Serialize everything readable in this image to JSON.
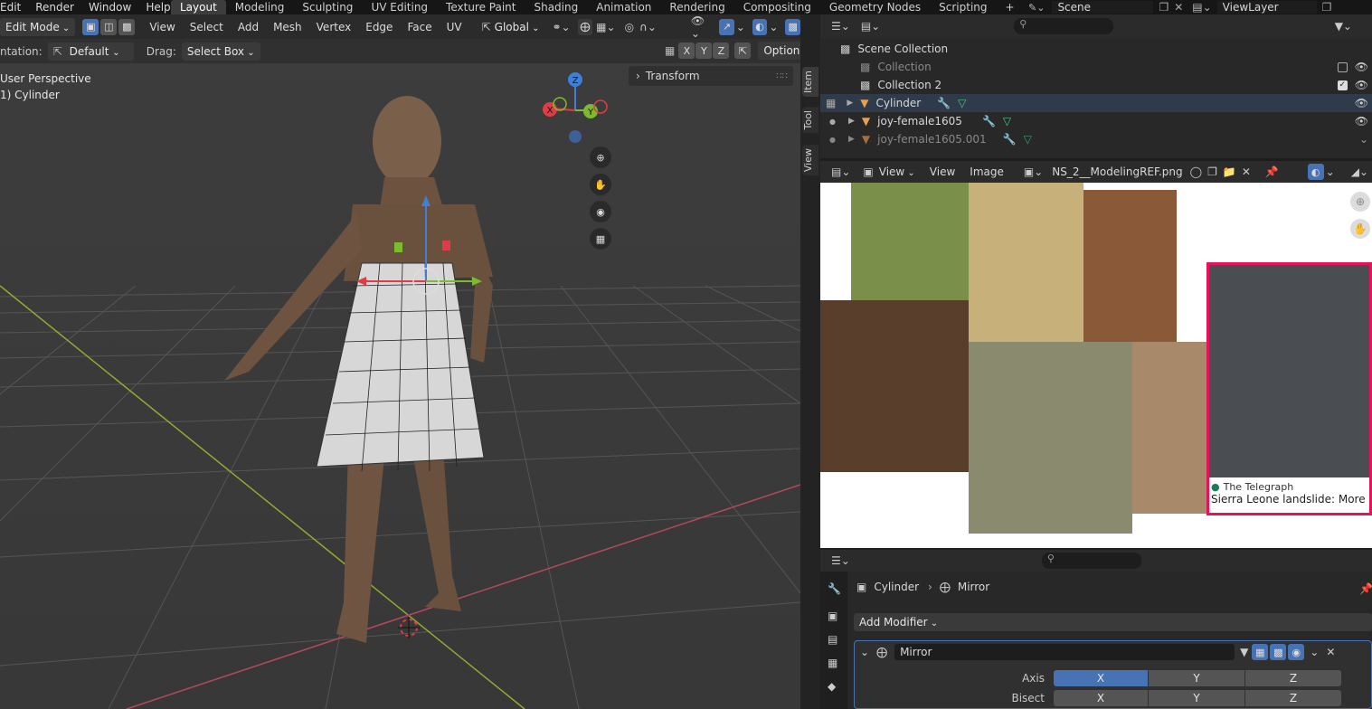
{
  "menu": [
    "Edit",
    "Render",
    "Window",
    "Help"
  ],
  "workspaces": [
    "Layout",
    "Modeling",
    "Sculpting",
    "UV Editing",
    "Texture Paint",
    "Shading",
    "Animation",
    "Rendering",
    "Compositing",
    "Geometry Nodes",
    "Scripting"
  ],
  "active_workspace": "Layout",
  "add_workspace": "+",
  "scene": "Scene",
  "view_layer": "ViewLayer",
  "viewport": {
    "mode": "Edit Mode",
    "menu": [
      "View",
      "Select",
      "Add",
      "Mesh",
      "Vertex",
      "Edge",
      "Face",
      "UV"
    ],
    "orientation_label": "ntation:",
    "orientation_value": "Default",
    "drag_label": "Drag:",
    "drag_value": "Select Box",
    "transform_space": "Global",
    "mirror_axes": [
      "X",
      "Y",
      "Z"
    ],
    "options": "Options",
    "overlay_title": "User Perspective",
    "overlay_object": "1) Cylinder",
    "transform_panel": "Transform",
    "gizmo_axes": [
      "Z",
      "X",
      "Y"
    ],
    "side_tabs": [
      "Item",
      "Tool",
      "View"
    ]
  },
  "outliner": {
    "root": "Scene Collection",
    "items": [
      {
        "label": "Collection"
      },
      {
        "label": "Collection 2"
      },
      {
        "label": "Cylinder"
      },
      {
        "label": "joy-female1605"
      },
      {
        "label": "joy-female1605.001"
      }
    ]
  },
  "image_editor": {
    "view_menu": "View",
    "menus": [
      "View",
      "Image"
    ],
    "image_name": "NS_2__ModelingREF.png",
    "caption_source": "The Telegraph",
    "caption_headline": "Sierra Leone landslide: More"
  },
  "properties": {
    "breadcrumb_object": "Cylinder",
    "breadcrumb_modifier": "Mirror",
    "add_modifier": "Add Modifier",
    "modifier_name": "Mirror",
    "axis_label": "Axis",
    "bisect_label": "Bisect",
    "axis_buttons": [
      "X",
      "Y",
      "Z"
    ],
    "axis_active": "X",
    "bisect_buttons": [
      "X",
      "Y",
      "Z"
    ]
  },
  "colors": {
    "accent_blue": "#4772b3",
    "axis_x": "#e03c45",
    "axis_y": "#7cba2e",
    "axis_z": "#3f7fd8",
    "selection_border": "#e8115a"
  }
}
